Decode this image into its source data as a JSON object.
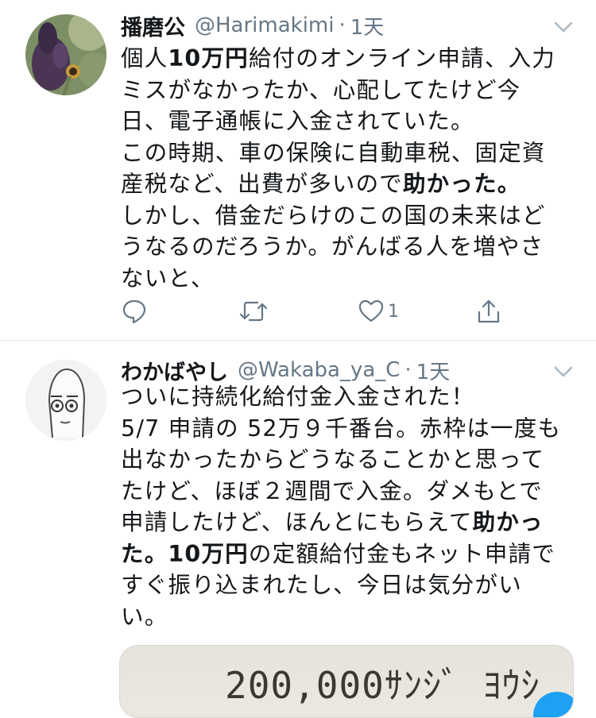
{
  "tweets": [
    {
      "display_name": "播磨公",
      "handle": "@Harimakimi",
      "separator": "·",
      "time": "1天",
      "lines": [
        [
          {
            "t": "個人"
          },
          {
            "t": "10万円",
            "b": true
          },
          {
            "t": "給付のオンライン申請、入力"
          }
        ],
        [
          {
            "t": "ミスがなかったか、心配してたけど今"
          }
        ],
        [
          {
            "t": "日、電子通帳に入金されていた。"
          }
        ],
        [
          {
            "t": "この時期、車の保険に自動車税、固定資"
          }
        ],
        [
          {
            "t": "産税など、出費が多いので"
          },
          {
            "t": "助かった。",
            "b": true
          }
        ],
        [
          {
            "t": "しかし、借金だらけのこの国の未来はど"
          }
        ],
        [
          {
            "t": "うなるのだろうか。がんばる人を増やさ"
          }
        ],
        [
          {
            "t": "ないと、"
          }
        ]
      ],
      "actions": {
        "reply_count": "",
        "retweet_count": "",
        "like_count": "1"
      }
    },
    {
      "display_name": "わかばやし",
      "handle": "@Wakaba_ya_C",
      "separator": "·",
      "time": "1天",
      "lines": [
        [
          {
            "t": "ついに持続化給付金入金された！"
          }
        ],
        [
          {
            "t": "5/7 申請の 52万９千番台。赤枠は一度も"
          }
        ],
        [
          {
            "t": "出なかったからどうなることかと思って"
          }
        ],
        [
          {
            "t": "たけど、ほぼ２週間で入金。ダメもとで"
          }
        ],
        [
          {
            "t": "申請したけど、ほんとにもらえて"
          },
          {
            "t": "助かっ",
            "b": true
          }
        ],
        [
          {
            "t": "た。",
            "b": true
          },
          {
            "t": "10万円",
            "b": true
          },
          {
            "t": "の定額給付金もネット申請で"
          }
        ],
        [
          {
            "t": "すぐ振り込まれたし、今日は気分がい"
          }
        ],
        [
          {
            "t": "い。"
          }
        ]
      ],
      "media_text": "200,000ｻﾝｼﾞ ﾖｳｼ"
    }
  ],
  "icons": {
    "reply": "reply-icon",
    "retweet": "retweet-icon",
    "like": "heart-icon",
    "share": "share-icon",
    "menu": "chevron-down-icon"
  },
  "colors": {
    "secondary_text": "#657786",
    "divider": "#e1e8ed",
    "accent": "#1da1f2"
  }
}
